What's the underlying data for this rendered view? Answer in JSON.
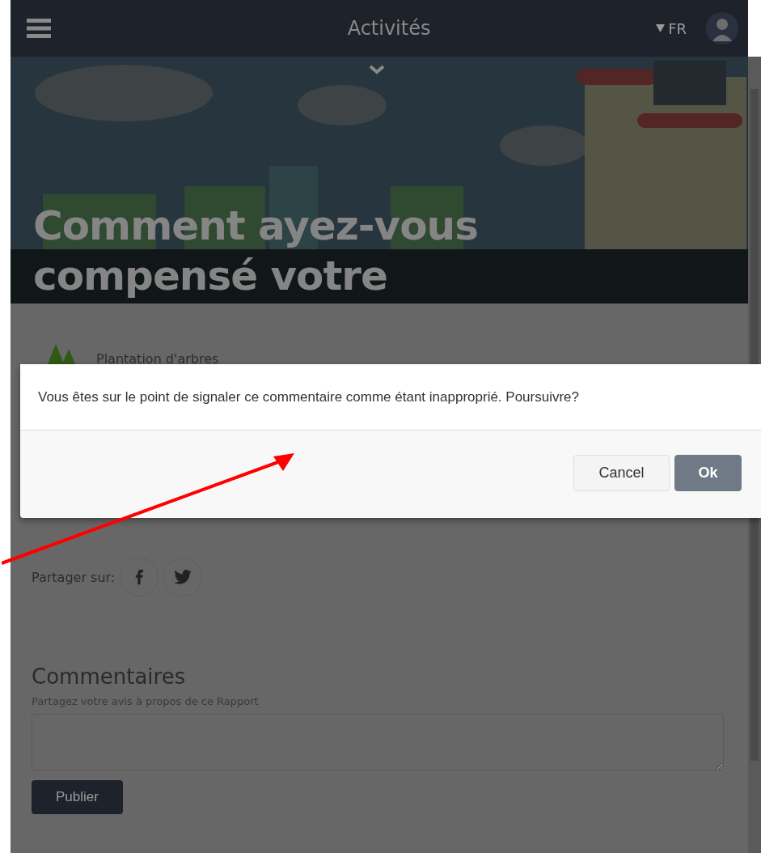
{
  "header": {
    "title": "Activités",
    "language": "FR"
  },
  "hero": {
    "title_lines": [
      "Comment ayez-vous",
      "compensé votre"
    ]
  },
  "report": {
    "category": "Plantation d'arbres",
    "share_label": "Partager sur:"
  },
  "comments": {
    "heading": "Commentaires",
    "hint": "Partagez votre avis à propos de ce Rapport",
    "publish_button": "Publier"
  },
  "dialog": {
    "message": "Vous êtes sur le point de signaler ce commentaire comme étant inapproprié. Poursuivre?",
    "buttons": [
      {
        "label": "Cancel",
        "kind": "secondary"
      },
      {
        "label": "Ok",
        "kind": "primary"
      }
    ]
  }
}
